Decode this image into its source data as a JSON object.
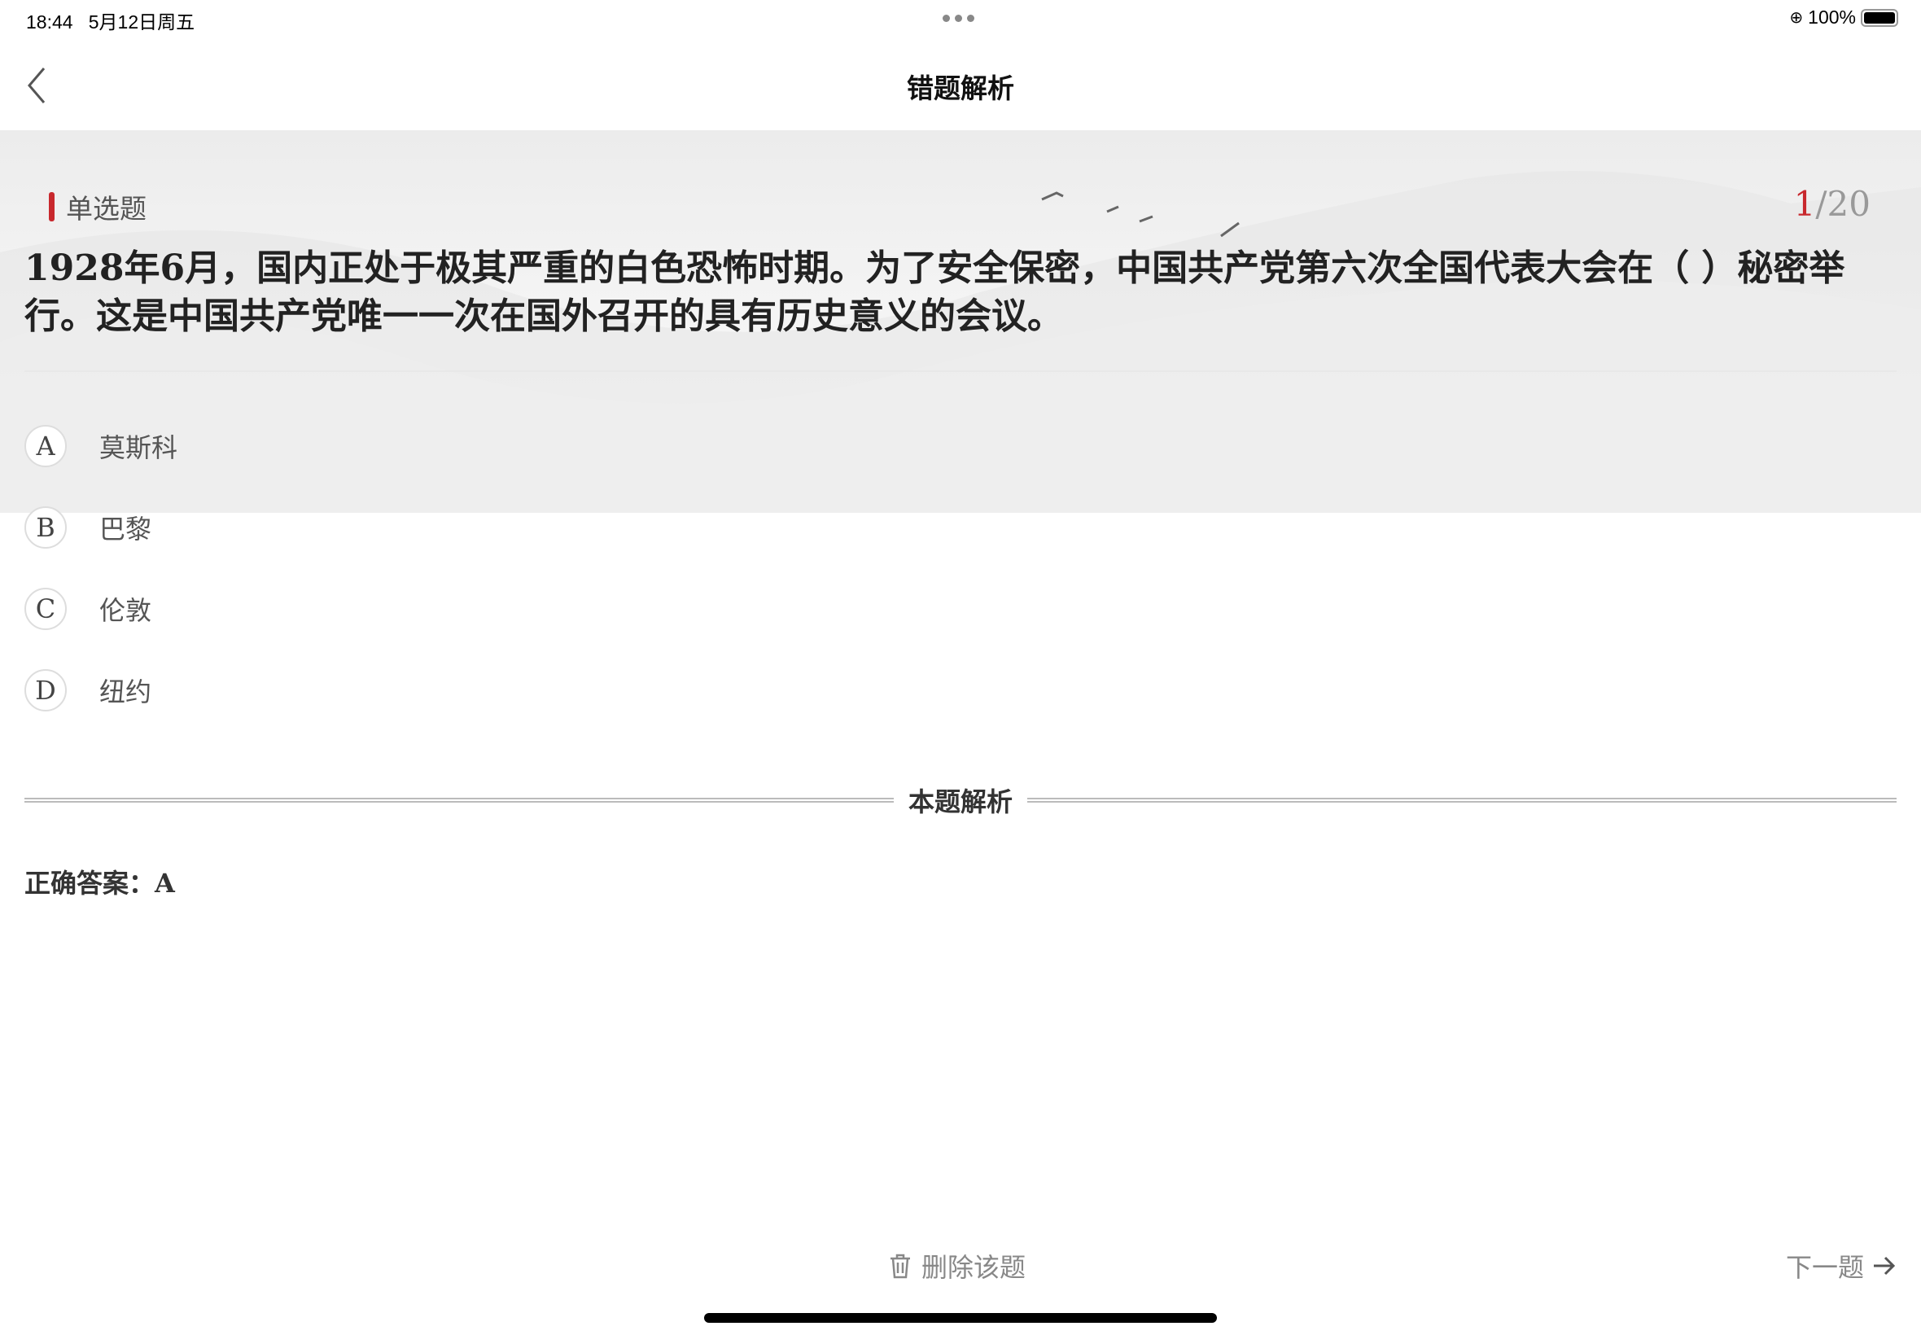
{
  "status_bar": {
    "time": "18:44",
    "date": "5月12日周五",
    "battery": "100%"
  },
  "header": {
    "title": "错题解析"
  },
  "question": {
    "type": "单选题",
    "current": "1",
    "total": "/20",
    "text": "1928年6月，国内正处于极其严重的白色恐怖时期。为了安全保密，中国共产党第六次全国代表大会在（ ）秘密举行。这是中国共产党唯一一次在国外召开的具有历史意义的会议。",
    "options": [
      {
        "key": "A",
        "label": "莫斯科"
      },
      {
        "key": "B",
        "label": "巴黎"
      },
      {
        "key": "C",
        "label": "伦敦"
      },
      {
        "key": "D",
        "label": "纽约"
      }
    ]
  },
  "analysis": {
    "heading": "本题解析",
    "correct_answer": "正确答案：A"
  },
  "footer": {
    "delete_label": "删除该题",
    "next_label": "下一题"
  },
  "colors": {
    "accent": "#c8282d"
  }
}
